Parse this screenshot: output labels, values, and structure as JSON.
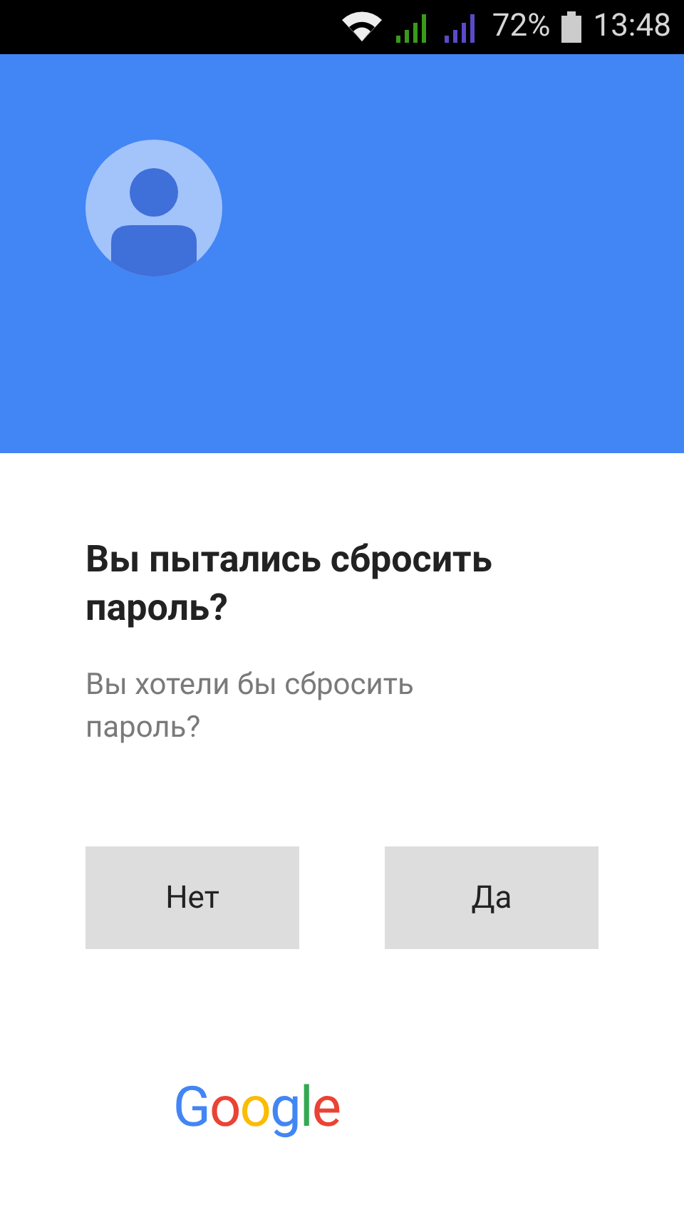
{
  "status_bar": {
    "battery": "72%",
    "time": "13:48"
  },
  "dialog": {
    "title": "Вы пытались сбросить пароль?",
    "message": "Вы хотели бы сбросить пароль?",
    "buttons": [
      "Нет",
      "Да"
    ]
  },
  "footer": {
    "logo": "Google"
  }
}
